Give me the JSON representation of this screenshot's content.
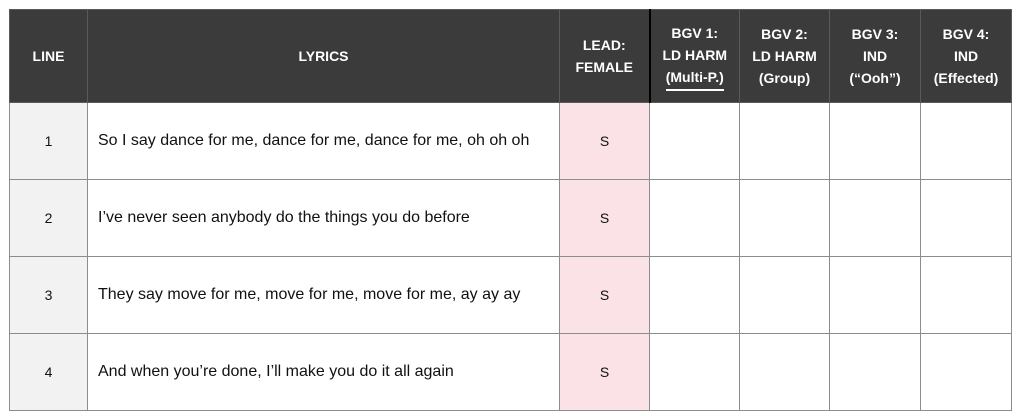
{
  "header": {
    "line": "LINE",
    "lyrics": "LYRICS",
    "lead": [
      "LEAD:",
      "FEMALE"
    ],
    "bgv1": [
      "BGV 1:",
      "LD HARM",
      "(Multi-P.)"
    ],
    "bgv2": [
      "BGV 2:",
      "LD HARM",
      "(Group)"
    ],
    "bgv3": [
      "BGV 3:",
      "IND",
      "(“Ooh”)"
    ],
    "bgv4": [
      "BGV 4:",
      "IND",
      "(Effected)"
    ]
  },
  "rows": [
    {
      "line": "1",
      "lyrics": "So I say dance for me, dance for me, dance for me, oh oh oh",
      "lead": "S",
      "bgv1": "",
      "bgv2": "",
      "bgv3": "",
      "bgv4": ""
    },
    {
      "line": "2",
      "lyrics": "I’ve never seen anybody do the things you do before",
      "lead": "S",
      "bgv1": "",
      "bgv2": "",
      "bgv3": "",
      "bgv4": ""
    },
    {
      "line": "3",
      "lyrics": "They say move for me, move for me, move for me, ay ay ay",
      "lead": "S",
      "bgv1": "",
      "bgv2": "",
      "bgv3": "",
      "bgv4": ""
    },
    {
      "line": "4",
      "lyrics": "And when you’re done, I’ll make you do it all again",
      "lead": "S",
      "bgv1": "",
      "bgv2": "",
      "bgv3": "",
      "bgv4": ""
    }
  ],
  "colors": {
    "header_bg": "#3b3b3b",
    "header_text": "#ffffff",
    "line_col_bg": "#f2f2f2",
    "lead_col_bg": "#fbe2e6",
    "grid": "#8c8c8c"
  }
}
